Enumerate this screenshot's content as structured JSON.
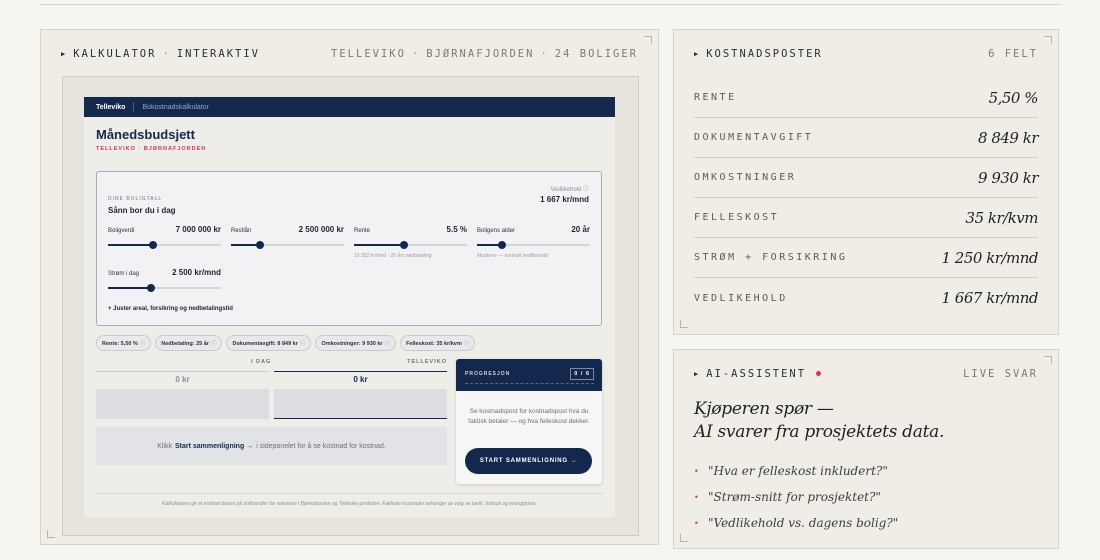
{
  "left_panel": {
    "label": "KALKULATOR",
    "mode": "INTERAKTIV",
    "project": "TELLEVIKO",
    "location": "BJØRNAFJORDEN",
    "units": "24 BOLIGER"
  },
  "app": {
    "brand": "Telleviko",
    "subtitle": "Bokostnadskalkulator",
    "title": "Månedsbudsjett",
    "kicker": "TELLEVIKO · BJØRNAFJORDEN",
    "card": {
      "small_label": "DINE BOLIGTALL",
      "title": "Sånn bor du i dag",
      "maint_label": "Vedlikehold ⓘ",
      "maint_value": "1 667 kr/mnd",
      "sliders": [
        {
          "name": "Boligverdi",
          "value": "7 000 000 kr",
          "level": 0.4,
          "hint": ""
        },
        {
          "name": "Restlån",
          "value": "2 500 000 kr",
          "level": 0.26,
          "hint": ""
        },
        {
          "name": "Rente",
          "value": "5.5 %",
          "level": 0.44,
          "hint": "15 352 kr/mnd · 25 års nedbetaling"
        },
        {
          "name": "Boligens alder",
          "value": "20 år",
          "level": 0.22,
          "hint": "Moderne — normalt vedlikehold"
        },
        {
          "name": "Strøm i dag",
          "value": "2 500 kr/mnd",
          "level": 0.38,
          "hint": ""
        }
      ],
      "adjust": "+ Juster areal, forsikring og nedbetalingstid"
    },
    "chips": [
      "Rente: 5,50 %",
      "Nedbetaling: 25 år",
      "Dokumentavgift: 8 849 kr",
      "Omkostninger: 9 930 kr",
      "Felleskost: 35 kr/kvm"
    ],
    "compare": {
      "today_label": "I DAG",
      "telleviko_label": "TELLEVIKO",
      "today_value": "0 kr",
      "telleviko_value": "0 kr",
      "hint_pre": "Klikk",
      "hint_bold": "Start sammenligning →",
      "hint_post": "i sidepanelet for å se kostnad for kostnad."
    },
    "progress": {
      "label": "PROGRESJON",
      "count": "0 / 6",
      "desc": "Se kostnadspost for kostnadspost hva du faktisk betaler — og hva felleskost dekker.",
      "button": "START SAMMENLIGNING →"
    },
    "footer": "Kalkulatoren gir et estimat basert på snittverdier for selveiere i Bjørnafjorden og Telleviko-prislisten. Faktiske kostnader avhenger av valg av bank, forbruk og energipriser."
  },
  "cost_panel": {
    "label": "KOSTNADSPOSTER",
    "count": "6 FELT",
    "rows": [
      {
        "key": "RENTE",
        "value": "5,50 %"
      },
      {
        "key": "DOKUMENTAVGIFT",
        "value": "8 849 kr"
      },
      {
        "key": "OMKOSTNINGER",
        "value": "9 930 kr"
      },
      {
        "key": "FELLESKOST",
        "value": "35 kr/kvm"
      },
      {
        "key": "STRØM + FORSIKRING",
        "value": "1 250 kr/mnd"
      },
      {
        "key": "VEDLIKEHOLD",
        "value": "1 667 kr/mnd"
      }
    ]
  },
  "ai_panel": {
    "label": "AI-ASSISTENT",
    "status": "LIVE SVAR",
    "title_line1": "Kjøperen spør —",
    "title_line2": "AI svarer fra prosjektets data.",
    "questions": [
      "\"Hva er felleskost inkludert?\"",
      "\"Strøm-snitt for prosjektet?\"",
      "\"Vedlikehold vs. dagens bolig?\""
    ]
  },
  "colors": {
    "navy": "#14284e",
    "accent": "#d2336b",
    "panel": "#efede6"
  }
}
